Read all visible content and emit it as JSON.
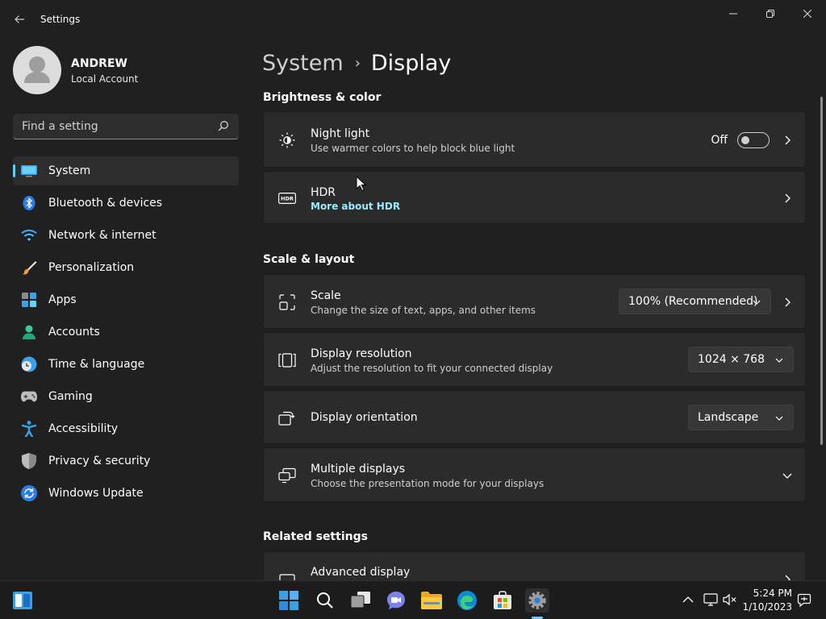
{
  "window": {
    "title": "Settings",
    "back_icon": "arrow-left-icon",
    "controls": [
      "minimize-icon",
      "restore-icon",
      "close-icon"
    ]
  },
  "profile": {
    "name": "ANDREW",
    "account_type": "Local Account"
  },
  "search": {
    "placeholder": "Find a setting"
  },
  "sidebar": {
    "items": [
      {
        "label": "System",
        "icon": "monitor-icon",
        "active": true
      },
      {
        "label": "Bluetooth & devices",
        "icon": "bluetooth-icon"
      },
      {
        "label": "Network & internet",
        "icon": "wifi-icon"
      },
      {
        "label": "Personalization",
        "icon": "paintbrush-icon"
      },
      {
        "label": "Apps",
        "icon": "apps-icon"
      },
      {
        "label": "Accounts",
        "icon": "person-icon"
      },
      {
        "label": "Time & language",
        "icon": "clock-globe-icon"
      },
      {
        "label": "Gaming",
        "icon": "gamepad-icon"
      },
      {
        "label": "Accessibility",
        "icon": "accessibility-icon"
      },
      {
        "label": "Privacy & security",
        "icon": "shield-icon"
      },
      {
        "label": "Windows Update",
        "icon": "update-icon"
      }
    ]
  },
  "breadcrumb": {
    "parent": "System",
    "separator": "›",
    "current": "Display"
  },
  "sections": {
    "brightness": "Brightness & color",
    "scale_layout": "Scale & layout",
    "related": "Related settings"
  },
  "cards": {
    "night_light": {
      "title": "Night light",
      "subtitle": "Use warmer colors to help block blue light",
      "toggle_state": "Off",
      "toggle_on": false,
      "icon": "night-light-icon"
    },
    "hdr": {
      "title": "HDR",
      "link": "More about HDR",
      "icon": "hdr-icon"
    },
    "scale": {
      "title": "Scale",
      "subtitle": "Change the size of text, apps, and other items",
      "value": "100% (Recommended)",
      "icon": "scale-icon"
    },
    "resolution": {
      "title": "Display resolution",
      "subtitle": "Adjust the resolution to fit your connected display",
      "value": "1024 × 768",
      "icon": "resolution-icon"
    },
    "orientation": {
      "title": "Display orientation",
      "value": "Landscape",
      "icon": "orientation-icon"
    },
    "multiple": {
      "title": "Multiple displays",
      "subtitle": "Choose the presentation mode for your displays",
      "icon": "multiple-displays-icon"
    },
    "advanced": {
      "title": "Advanced display",
      "icon": "advanced-display-icon"
    }
  },
  "taskbar": {
    "apps": [
      "widgets-icon",
      "start-icon",
      "search-icon",
      "task-view-icon",
      "chat-icon",
      "file-explorer-icon",
      "edge-icon",
      "store-icon",
      "settings-icon"
    ],
    "active_app": "settings-icon",
    "tray": [
      "chevron-up-icon",
      "network-icon",
      "volume-muted-icon",
      "notifications-icon"
    ],
    "time": "5:24 PM",
    "date": "1/10/2023"
  },
  "colors": {
    "accent": "#60cdff",
    "link": "#99ebff",
    "background": "#202020",
    "card": "#2b2b2b",
    "taskbar": "#1c1c1c"
  }
}
